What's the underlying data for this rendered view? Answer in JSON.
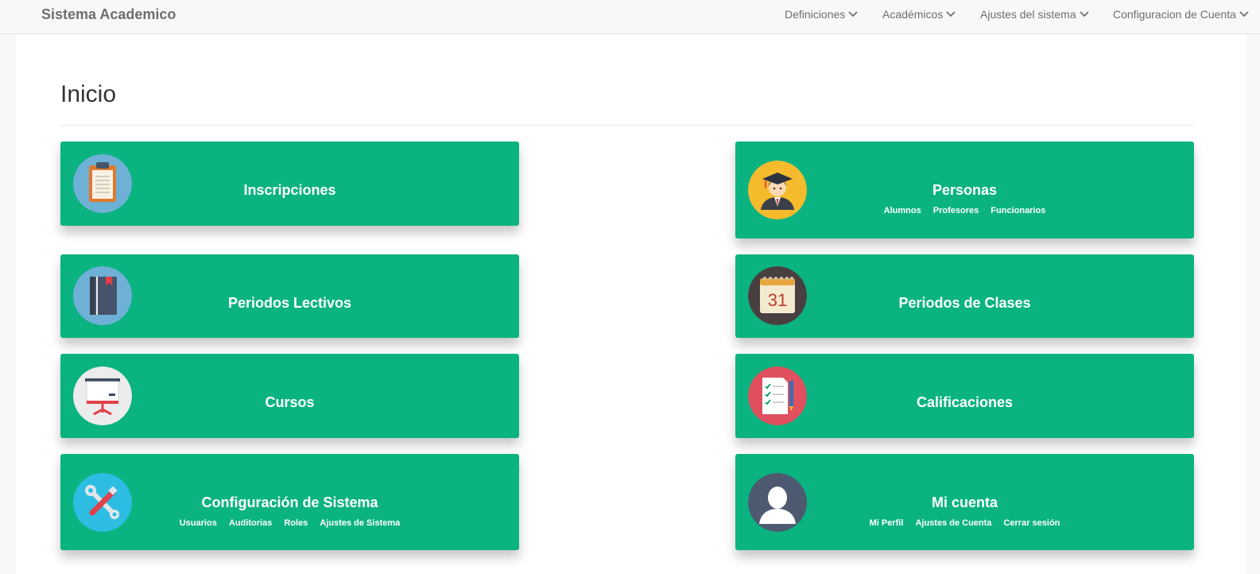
{
  "navbar": {
    "brand": "Sistema Academico",
    "items": [
      {
        "label": "Definiciones"
      },
      {
        "label": "Académicos"
      },
      {
        "label": "Ajustes del sistema"
      },
      {
        "label": "Configuracion de Cuenta"
      }
    ]
  },
  "page": {
    "title": "Inicio"
  },
  "cards": {
    "inscripciones": {
      "title": "Inscripciones",
      "icon": "clipboard-icon"
    },
    "personas": {
      "title": "Personas",
      "icon": "graduate-icon",
      "links": [
        "Alumnos",
        "Profesores",
        "Funcionarios"
      ]
    },
    "periodos_lectivos": {
      "title": "Periodos Lectivos",
      "icon": "notebook-icon"
    },
    "periodos_clases": {
      "title": "Periodos de Clases",
      "icon": "calendar-icon",
      "calendar_day": "31"
    },
    "cursos": {
      "title": "Cursos",
      "icon": "presentation-board-icon"
    },
    "calificaciones": {
      "title": "Calificaciones",
      "icon": "checklist-icon"
    },
    "configuracion": {
      "title": "Configuración de Sistema",
      "icon": "tools-icon",
      "links": [
        "Usuarios",
        "Auditorias",
        "Roles",
        "Ajustes de Sistema"
      ]
    },
    "mi_cuenta": {
      "title": "Mi cuenta",
      "icon": "user-avatar-icon",
      "links": [
        "Mi Perfil",
        "Ajustes de Cuenta",
        "Cerrar sesión"
      ]
    }
  },
  "colors": {
    "card": "#0bb380",
    "navbar": "#f8f8f8",
    "nav_text": "#6e6e6e"
  }
}
